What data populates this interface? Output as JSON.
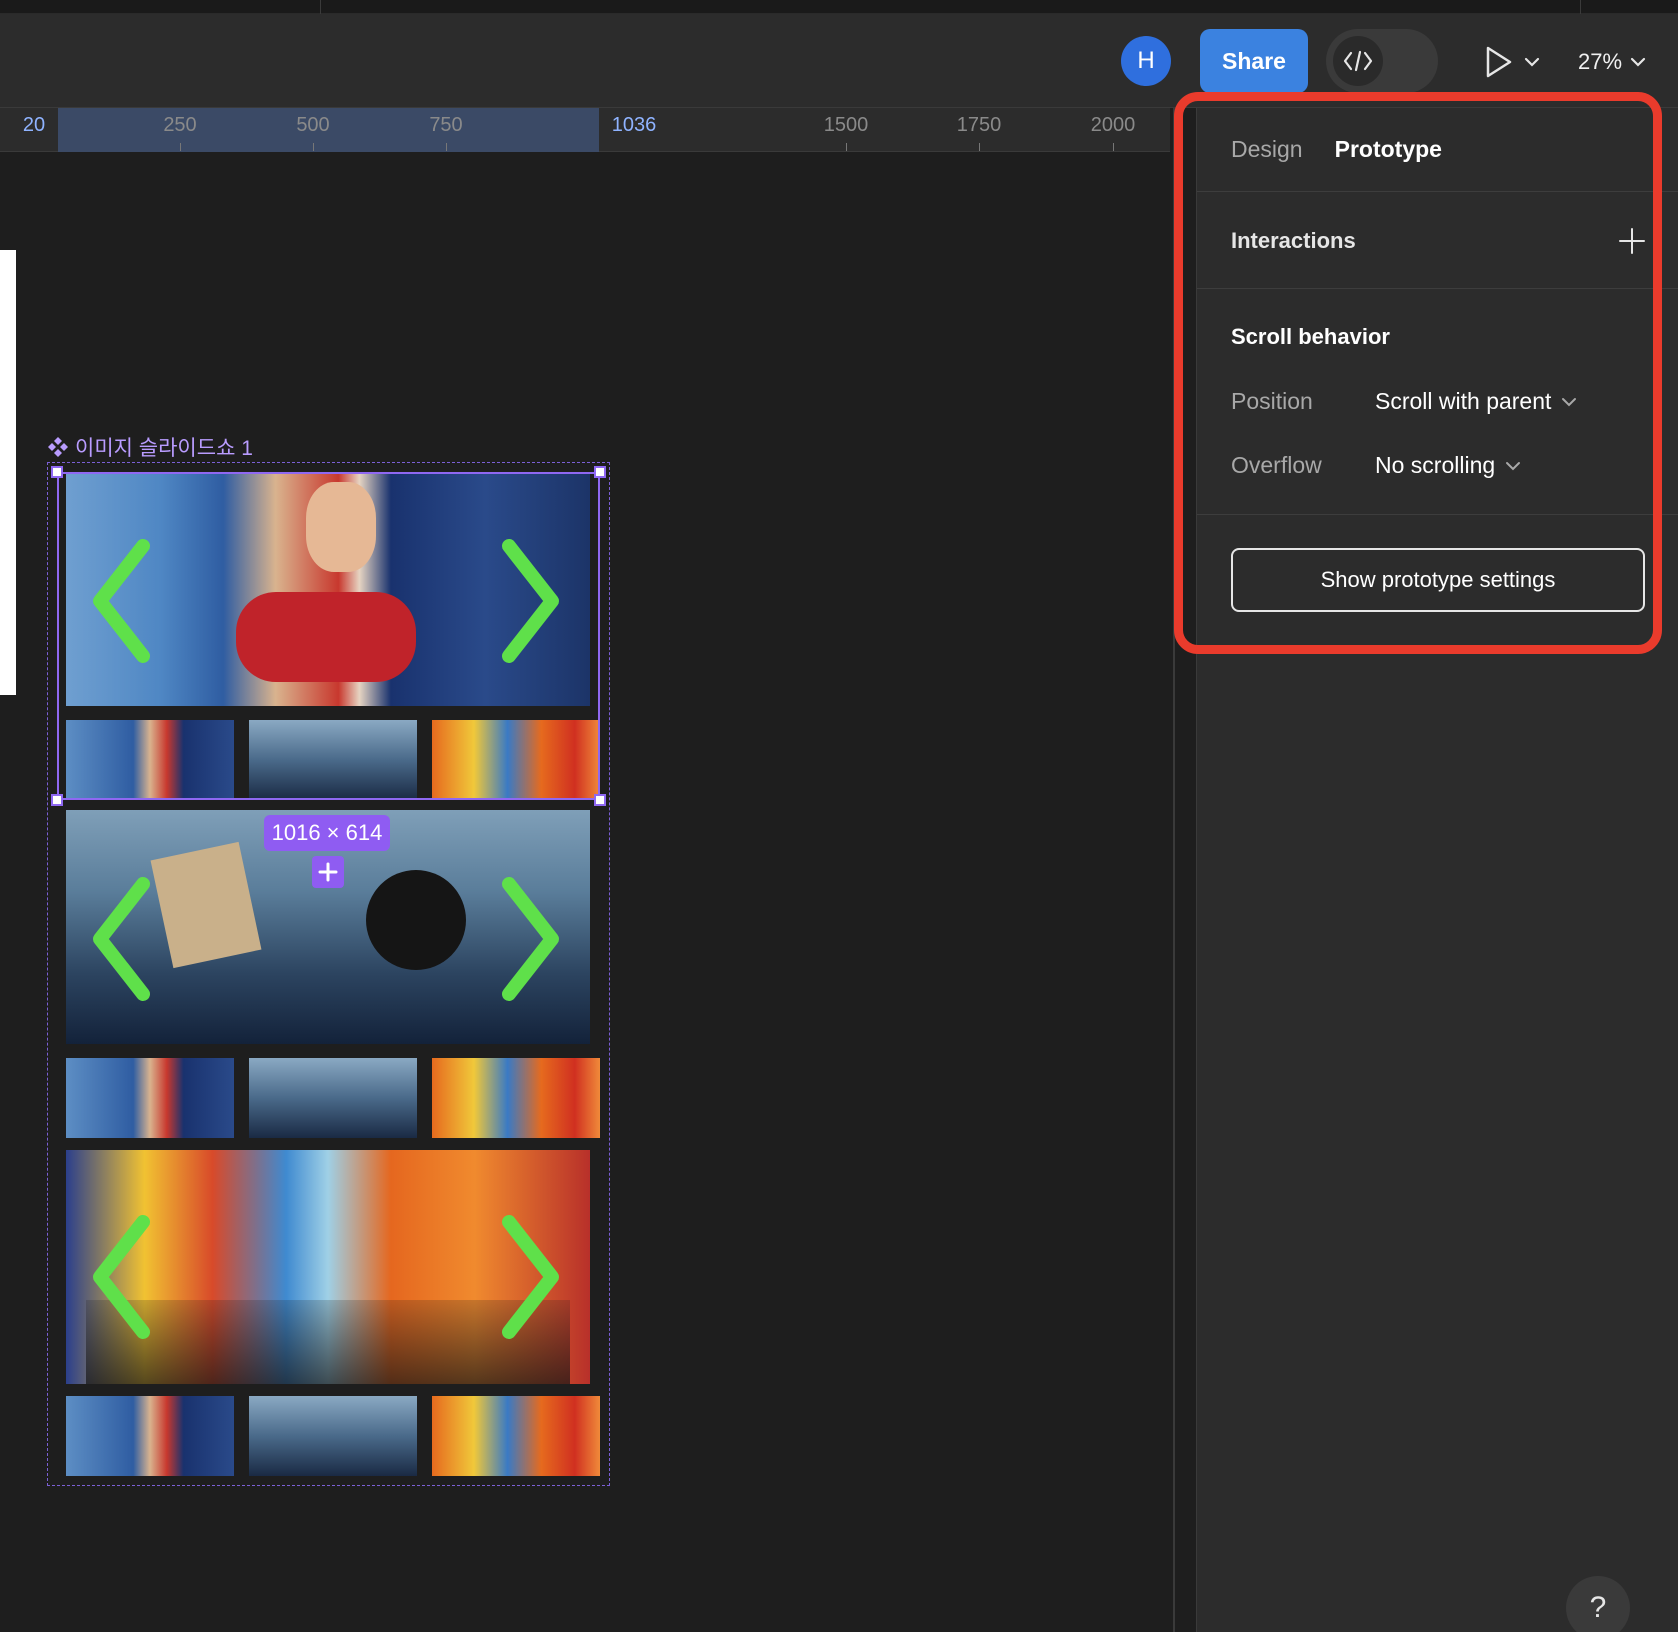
{
  "toolbar": {
    "avatar_initial": "H",
    "share_label": "Share",
    "devmode_icon": "code-icon",
    "zoom_level": "27%"
  },
  "ruler": {
    "ticks": [
      "20",
      "250",
      "500",
      "750",
      "1036",
      "1500",
      "1750",
      "2000"
    ]
  },
  "canvas": {
    "component_name": "이미지 슬라이드쇼 1",
    "selection_size": "1016 × 614"
  },
  "panel": {
    "tabs": [
      {
        "label": "Design",
        "active": false
      },
      {
        "label": "Prototype",
        "active": true
      }
    ],
    "interactions_title": "Interactions",
    "scroll_title": "Scroll behavior",
    "position_label": "Position",
    "position_value": "Scroll with parent",
    "overflow_label": "Overflow",
    "overflow_value": "No scrolling",
    "prototype_settings_button": "Show prototype settings"
  },
  "help_label": "?",
  "colors": {
    "accent": "#3b82e0",
    "selection": "#8f68f2",
    "highlight": "#ea3b2c",
    "arrow": "#5fe04a"
  }
}
